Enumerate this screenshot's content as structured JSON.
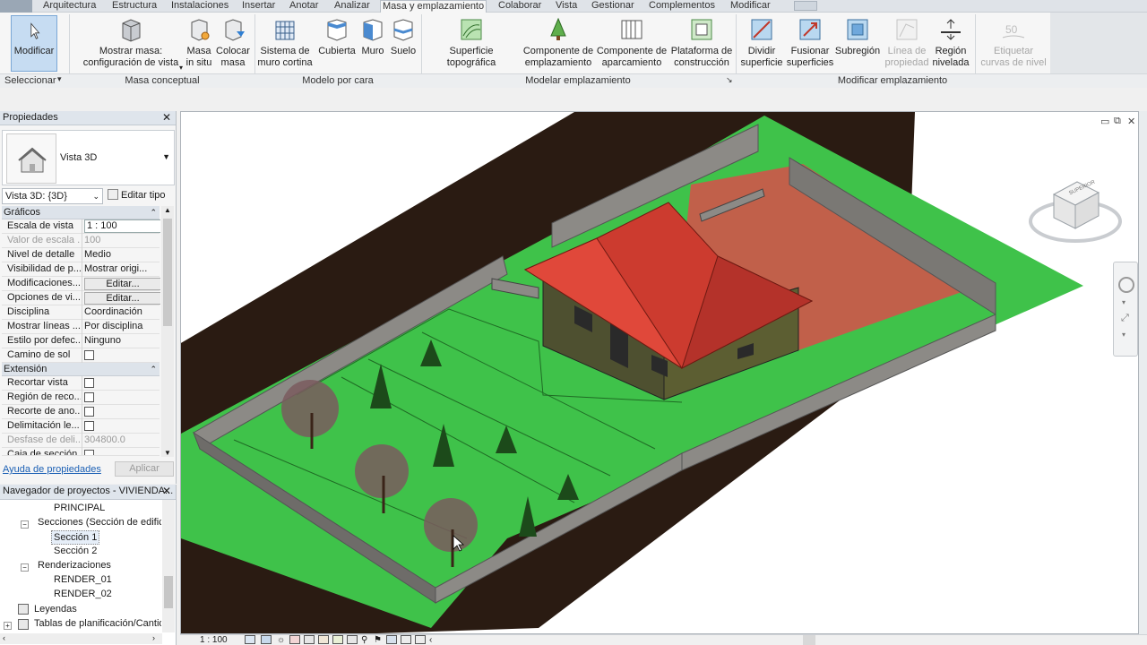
{
  "tabs": [
    "Arquitectura",
    "Estructura",
    "Instalaciones",
    "Insertar",
    "Anotar",
    "Analizar",
    "Masa y emplazamiento",
    "Colaborar",
    "Vista",
    "Gestionar",
    "Complementos",
    "Modificar"
  ],
  "active_tab": "Masa y emplazamiento",
  "ribbon": {
    "modificar": "Modificar",
    "mostrar_masa_1": "Mostrar masa:",
    "mostrar_masa_2": "configuración de vista",
    "masa_insitu_1": "Masa",
    "masa_insitu_2": "in situ",
    "colocar_masa_1": "Colocar",
    "colocar_masa_2": "masa",
    "sistema_muro_1": "Sistema de",
    "sistema_muro_2": "muro cortina",
    "cubierta": "Cubierta",
    "muro": "Muro",
    "suelo": "Suelo",
    "superficie_topo": "Superficie topográfica",
    "comp_empl_1": "Componente de",
    "comp_empl_2": "emplazamiento",
    "comp_aparc_1": "Componente de",
    "comp_aparc_2": "aparcamiento",
    "plataforma_1": "Plataforma de",
    "plataforma_2": "construcción",
    "dividir_1": "Dividir",
    "dividir_2": "superficie",
    "fusionar_1": "Fusionar",
    "fusionar_2": "superficies",
    "subregion": "Subregión",
    "linea_prop_1": "Línea de",
    "linea_prop_2": "propiedad",
    "region_niv_1": "Región",
    "region_niv_2": "nivelada",
    "etiquetar_1": "Etiquetar",
    "etiquetar_2": "curvas de nivel",
    "panels": [
      "Seleccionar",
      "Masa conceptual",
      "Modelo por cara",
      "Modelar emplazamiento",
      "Modificar emplazamiento"
    ]
  },
  "properties": {
    "title": "Propiedades",
    "type_name": "Vista 3D",
    "instance": "Vista 3D: {3D}",
    "edit_type": "Editar tipo",
    "groups": {
      "graficos": "Gráficos",
      "extension": "Extensión"
    },
    "rows": [
      {
        "k": "Escala de vista",
        "v": "1 : 100"
      },
      {
        "k": "Valor de escala ...",
        "v": "100"
      },
      {
        "k": "Nivel de detalle",
        "v": "Medio"
      },
      {
        "k": "Visibilidad de p...",
        "v": "Mostrar origi..."
      },
      {
        "k": "Modificaciones...",
        "v": "Editar..."
      },
      {
        "k": "Opciones de vi...",
        "v": "Editar..."
      },
      {
        "k": "Disciplina",
        "v": "Coordinación"
      },
      {
        "k": "Mostrar líneas ...",
        "v": "Por disciplina"
      },
      {
        "k": "Estilo por defec...",
        "v": "Ninguno"
      },
      {
        "k": "Camino de sol",
        "v": ""
      },
      {
        "k": "Recortar vista",
        "v": ""
      },
      {
        "k": "Región de reco...",
        "v": ""
      },
      {
        "k": "Recorte de ano...",
        "v": ""
      },
      {
        "k": "Delimitación le...",
        "v": ""
      },
      {
        "k": "Desfase de deli...",
        "v": "304800.0"
      },
      {
        "k": "Caja de sección",
        "v": ""
      }
    ],
    "help_link": "Ayuda de propiedades",
    "apply": "Aplicar"
  },
  "browser": {
    "title": "Navegador de proyectos - VIVIENDA...",
    "items": [
      "PRINCIPAL",
      "Secciones (Sección de edificio)",
      "Sección 1",
      "Sección 2",
      "Renderizaciones",
      "RENDER_01",
      "RENDER_02",
      "Leyendas",
      "Tablas de planificación/Cantidades"
    ]
  },
  "status": {
    "scale": "1 : 100"
  },
  "viewcube": {
    "label": "SUPERIOR"
  },
  "colors": {
    "grass": "#3fc24a",
    "roof": "#cc3b2f",
    "patio": "#c1604a",
    "wall": "#8c8a86",
    "house": "#5c5e32",
    "earth": "#2a1b12",
    "accent": "#7ba7d6"
  }
}
